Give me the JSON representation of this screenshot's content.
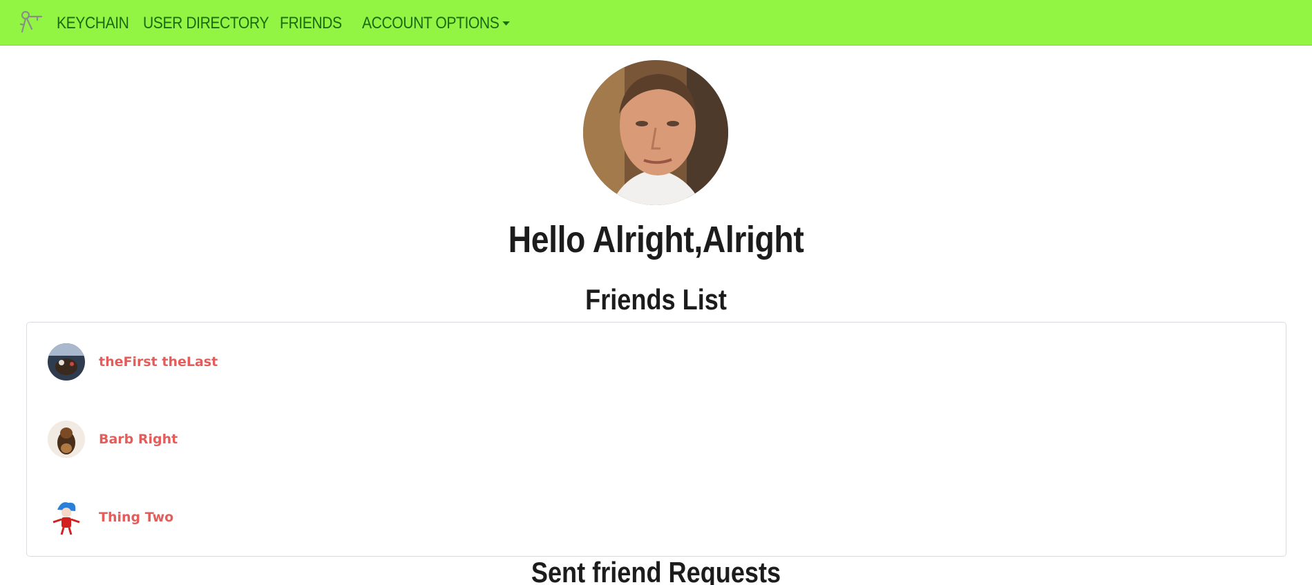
{
  "navbar": {
    "brand": "KEYCHAIN",
    "links": [
      {
        "label": "USER DIRECTORY"
      },
      {
        "label": "FRIENDS"
      },
      {
        "label": "ACCOUNT OPTIONS"
      }
    ],
    "logo_icon": "keys-icon",
    "bg_color": "#92f443",
    "text_color": "#1a6b12"
  },
  "profile": {
    "greeting": "Hello Alright,Alright"
  },
  "friends": {
    "title": "Friends List",
    "items": [
      {
        "name": "theFirst theLast"
      },
      {
        "name": "Barb Right"
      },
      {
        "name": "Thing Two"
      }
    ],
    "name_color": "#e35d5b"
  },
  "sent_requests": {
    "title": "Sent friend Requests"
  }
}
